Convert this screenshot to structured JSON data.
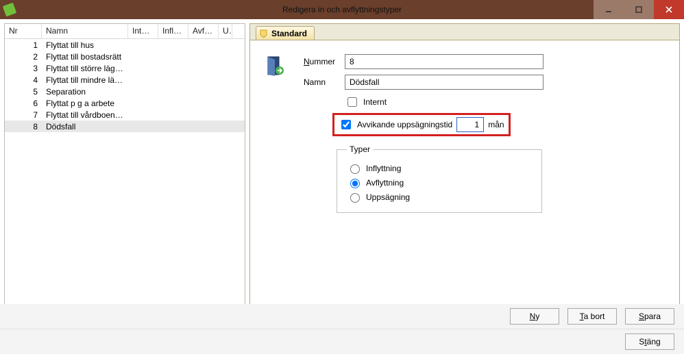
{
  "window": {
    "title": "Redigera in och avflyttningstyper"
  },
  "table": {
    "headers": {
      "nr": "Nr",
      "namn": "Namn",
      "internt": "Internt",
      "inflytt": "Inflytt...",
      "avflytt": "Avflytt...",
      "u": "U"
    },
    "rows": [
      {
        "nr": "1",
        "namn": "Flyttat till hus"
      },
      {
        "nr": "2",
        "namn": "Flyttat till bostadsrätt"
      },
      {
        "nr": "3",
        "namn": "Flyttat till större lägen..."
      },
      {
        "nr": "4",
        "namn": "Flyttat till mindre läge..."
      },
      {
        "nr": "5",
        "namn": "Separation"
      },
      {
        "nr": "6",
        "namn": "Flyttat p g a arbete"
      },
      {
        "nr": "7",
        "namn": "Flyttat till vårdboende"
      },
      {
        "nr": "8",
        "namn": "Dödsfall"
      }
    ],
    "selected_nr": "8"
  },
  "tab": {
    "label": "Standard"
  },
  "form": {
    "nummer_label_pre": "N",
    "nummer_label_post": "ummer",
    "nummer_value": "8",
    "namn_label": "Namn",
    "namn_value": "Dödsfall",
    "internt_label_pre": "I",
    "internt_label_post": "nternt",
    "internt_checked": false,
    "avvikande_label_pre": "A",
    "avvikande_label_mid": "v",
    "avvikande_label_post": "vikande uppsägningstid",
    "avvikande_checked": true,
    "avvikande_value": "1",
    "avvikande_unit": "mån"
  },
  "typer": {
    "legend": "Typer",
    "inflyttning_pre": "I",
    "inflyttning_post": "nflyttning",
    "avflyttning_pre": "A",
    "avflyttning_post": "vflyttning",
    "uppsagning_pre": "U",
    "uppsagning_post": "ppsägning",
    "selected": "avflyttning"
  },
  "buttons": {
    "ny_pre": "N",
    "ny_post": "y",
    "tabort_pre": "T",
    "tabort_post": "a bort",
    "spara_pre": "S",
    "spara_post": "para",
    "stang_pre": "S",
    "stang_mid": "t",
    "stang_post": "äng"
  }
}
